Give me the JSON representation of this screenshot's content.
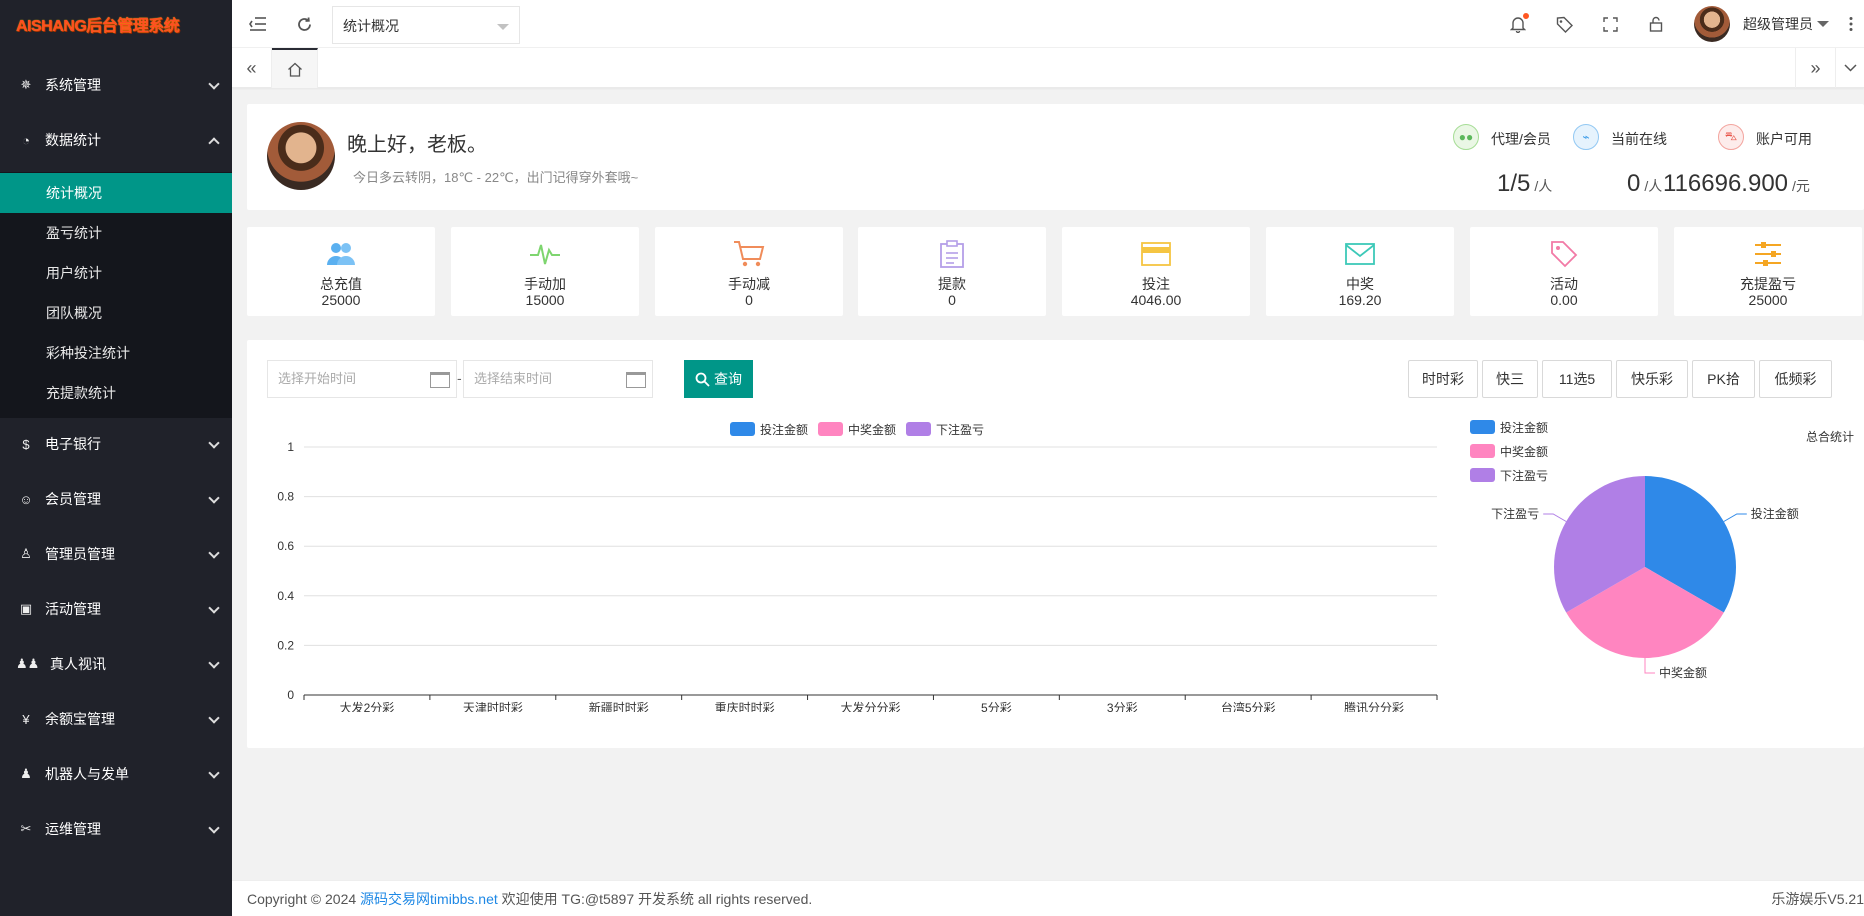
{
  "app": {
    "logo_text": "AISHANG后台管理系统"
  },
  "sidebar": {
    "items": [
      {
        "label": "系统管理",
        "icon": "gear-icon"
      },
      {
        "label": "数据统计",
        "icon": "dashboard-icon"
      },
      {
        "label": "电子银行",
        "icon": "dollar-icon"
      },
      {
        "label": "会员管理",
        "icon": "users-icon"
      },
      {
        "label": "管理员管理",
        "icon": "user-icon"
      },
      {
        "label": "活动管理",
        "icon": "gift-icon"
      },
      {
        "label": "真人视讯",
        "icon": "group-icon"
      },
      {
        "label": "余额宝管理",
        "icon": "yen-icon"
      },
      {
        "label": "机器人与发单",
        "icon": "person-icon"
      },
      {
        "label": "运维管理",
        "icon": "tools-icon"
      }
    ],
    "submenu": [
      "统计概况",
      "盈亏统计",
      "用户统计",
      "团队概况",
      "彩种投注统计",
      "充提款统计"
    ]
  },
  "header": {
    "select_value": "统计概况",
    "user_name": "超级管理员"
  },
  "welcome": {
    "greeting": "晚上好，老板。",
    "weather": "今日多云转阴，18℃ - 22℃，出门记得穿外套哦~",
    "summary": [
      {
        "label": "代理/会员",
        "value": "1/5",
        "unit": "/人"
      },
      {
        "label": "当前在线",
        "value": "0",
        "unit": "/人"
      },
      {
        "label": "账户可用",
        "value": "116696.900",
        "unit": "/元"
      }
    ]
  },
  "stats": [
    {
      "label": "总充值",
      "value": "25000",
      "icon": "users-icon",
      "color": "#5ab0f0"
    },
    {
      "label": "手动加",
      "value": "15000",
      "icon": "pulse-icon",
      "color": "#7ed56f"
    },
    {
      "label": "手动减",
      "value": "0",
      "icon": "cart-icon",
      "color": "#f08c5a"
    },
    {
      "label": "提款",
      "value": "0",
      "icon": "clipboard-icon",
      "color": "#b49ee8"
    },
    {
      "label": "投注",
      "value": "4046.00",
      "icon": "card-icon",
      "color": "#f5c542"
    },
    {
      "label": "中奖",
      "value": "169.20",
      "icon": "mail-icon",
      "color": "#3cc9b8"
    },
    {
      "label": "活动",
      "value": "0.00",
      "icon": "tag-icon",
      "color": "#f27aa6"
    },
    {
      "label": "充提盈亏",
      "value": "25000",
      "icon": "sliders-icon",
      "color": "#f5a623"
    }
  ],
  "filters": {
    "start_placeholder": "选择开始时间",
    "end_placeholder": "选择结束时间",
    "separator": "-",
    "query_label": "查询",
    "buttons": [
      "时时彩",
      "快三",
      "11选5",
      "快乐彩",
      "PK拾",
      "低频彩"
    ]
  },
  "chart_data": [
    {
      "type": "bar",
      "categories": [
        "大发2分彩",
        "天津时时彩",
        "新疆时时彩",
        "重庆时时彩",
        "大发分分彩",
        "5分彩",
        "3分彩",
        "台湾5分彩",
        "腾讯分分彩"
      ],
      "series": [
        {
          "name": "投注金额",
          "values": [
            0,
            0,
            0,
            0,
            0,
            0,
            0,
            0,
            0
          ],
          "color": "#2f89e8"
        },
        {
          "name": "中奖金额",
          "values": [
            0,
            0,
            0,
            0,
            0,
            0,
            0,
            0,
            0
          ],
          "color": "#ff85c0"
        },
        {
          "name": "下注盈亏",
          "values": [
            0,
            0,
            0,
            0,
            0,
            0,
            0,
            0,
            0
          ],
          "color": "#b07fe6"
        }
      ],
      "ylim": [
        0,
        1
      ],
      "yticks": [
        "0",
        "0.2",
        "0.4",
        "0.6",
        "0.8",
        "1"
      ],
      "legend": "top-center",
      "grid": true
    },
    {
      "type": "pie",
      "title": "总合统计",
      "labels": [
        "投注金额",
        "中奖金额",
        "下注盈亏"
      ],
      "values": [
        1,
        1,
        1
      ],
      "colors": [
        "#2f89e8",
        "#ff85c0",
        "#b07fe6"
      ],
      "legend": "top-left"
    }
  ],
  "footer": {
    "copyright": "Copyright © 2024 ",
    "link_text": "源码交易网timibbs.net",
    "rest": " 欢迎使用 TG:@t5897 开发系统 all rights reserved.",
    "version": "乐游娱乐V5.21"
  }
}
